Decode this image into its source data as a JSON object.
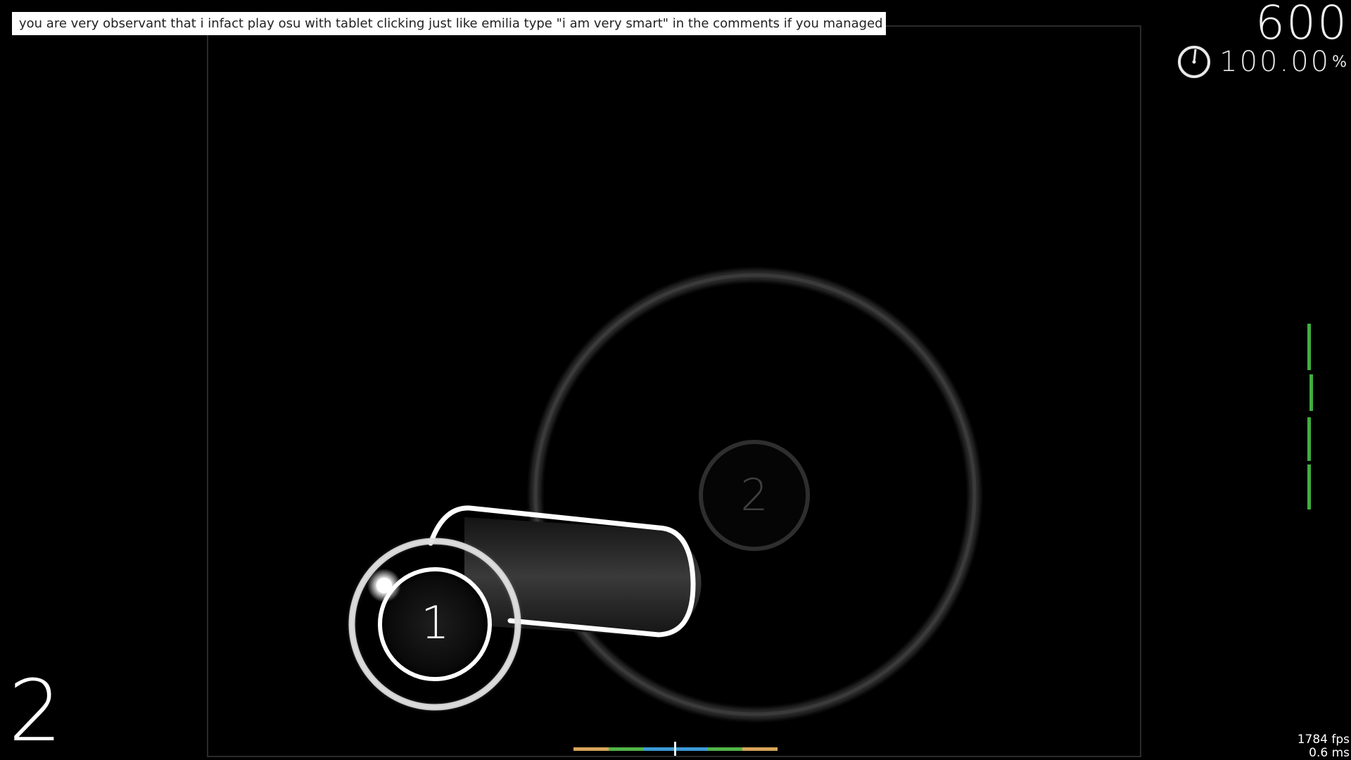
{
  "overlay": {
    "comment_text": "you are very observant that i infact play osu with tablet clicking just like emilia type \"i am very smart\" in the comments if you managed to see i"
  },
  "hud": {
    "score": "600",
    "accuracy": "100.00",
    "accuracy_unit": "%",
    "combo": "2",
    "fps": "1784 fps",
    "frame_time": "0.6 ms",
    "progress_icon": "pie-timer-icon"
  },
  "playfield": {
    "hit_circles": [
      {
        "number": "1"
      },
      {
        "number": "2"
      }
    ]
  },
  "colors": {
    "background": "#000000",
    "hp_green": "#3fae3f",
    "hit_300": "#3d9bd8",
    "hit_100": "#53b448",
    "hit_50": "#d9a55a"
  }
}
